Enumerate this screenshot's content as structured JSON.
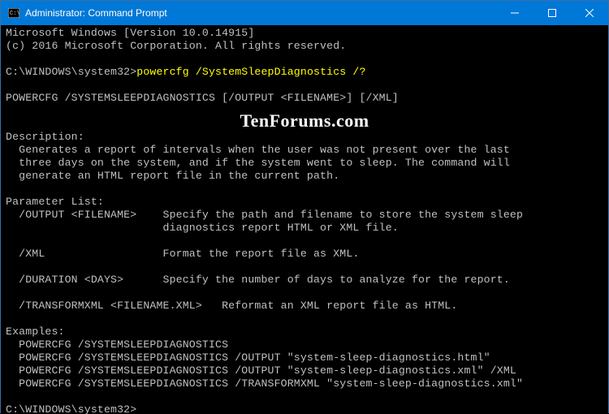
{
  "window": {
    "title": "Administrator: Command Prompt"
  },
  "watermark": "TenForums.com",
  "terminal": {
    "banner1": "Microsoft Windows [Version 10.0.14915]",
    "banner2": "(c) 2016 Microsoft Corporation. All rights reserved.",
    "prompt_path": "C:\\WINDOWS\\system32>",
    "command": "powercfg /SystemSleepDiagnostics /?",
    "usage": "POWERCFG /SYSTEMSLEEPDIAGNOSTICS [/OUTPUT <FILENAME>] [/XML]",
    "desc_header": "Description:",
    "desc_l1": "  Generates a report of intervals when the user was not present over the last",
    "desc_l2": "  three days on the system, and if the system went to sleep. The command will",
    "desc_l3": "  generate an HTML report file in the current path.",
    "param_header": "Parameter List:",
    "p1a": "  /OUTPUT <FILENAME>    Specify the path and filename to store the system sleep",
    "p1b": "                        diagnostics report HTML or XML file.",
    "p2": "  /XML                  Format the report file as XML.",
    "p3": "  /DURATION <DAYS>      Specify the number of days to analyze for the report.",
    "p4": "  /TRANSFORMXML <FILENAME.XML>   Reformat an XML report file as HTML.",
    "ex_header": "Examples:",
    "ex1": "  POWERCFG /SYSTEMSLEEPDIAGNOSTICS",
    "ex2": "  POWERCFG /SYSTEMSLEEPDIAGNOSTICS /OUTPUT \"system-sleep-diagnostics.html\"",
    "ex3": "  POWERCFG /SYSTEMSLEEPDIAGNOSTICS /OUTPUT \"system-sleep-diagnostics.xml\" /XML",
    "ex4": "  POWERCFG /SYSTEMSLEEPDIAGNOSTICS /TRANSFORMXML \"system-sleep-diagnostics.xml\""
  }
}
